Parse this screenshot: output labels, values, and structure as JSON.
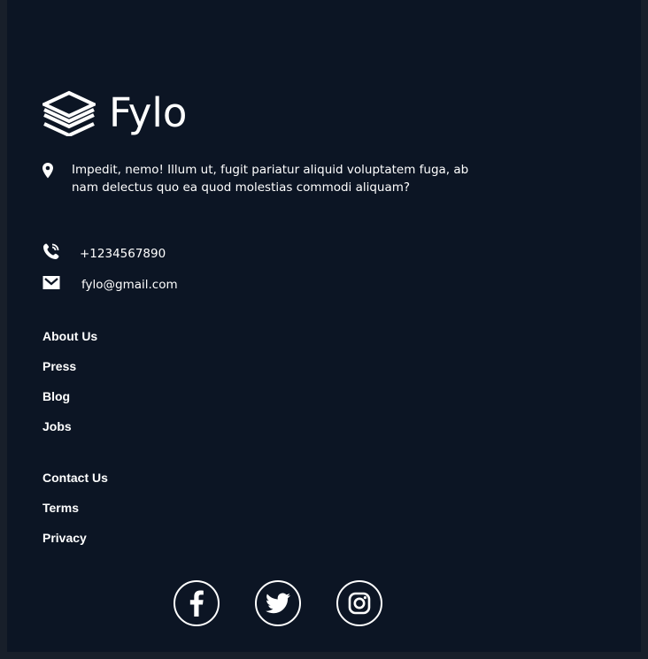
{
  "brand": {
    "name": "Fylo",
    "logo_icon": "stacked-layers-icon"
  },
  "address": {
    "icon": "location-pin-icon",
    "text": "Impedit, nemo! Illum ut, fugit pariatur aliquid voluptatem fuga, ab nam delectus quo ea quod molestias commodi aliquam?"
  },
  "contact": {
    "phone": {
      "icon": "phone-icon",
      "text": "+1234567890"
    },
    "email": {
      "icon": "envelope-icon",
      "text": "fylo@gmail.com"
    }
  },
  "links": {
    "column1": [
      {
        "label": "About Us"
      },
      {
        "label": "Press"
      },
      {
        "label": "Blog"
      },
      {
        "label": "Jobs"
      }
    ],
    "column2": [
      {
        "label": "Contact Us"
      },
      {
        "label": "Terms"
      },
      {
        "label": "Privacy"
      }
    ]
  },
  "social": [
    {
      "icon": "facebook-icon"
    },
    {
      "icon": "twitter-icon"
    },
    {
      "icon": "instagram-icon"
    }
  ],
  "colors": {
    "background": "#0c1524",
    "outer_background": "#181f2a",
    "text": "#ffffff"
  }
}
